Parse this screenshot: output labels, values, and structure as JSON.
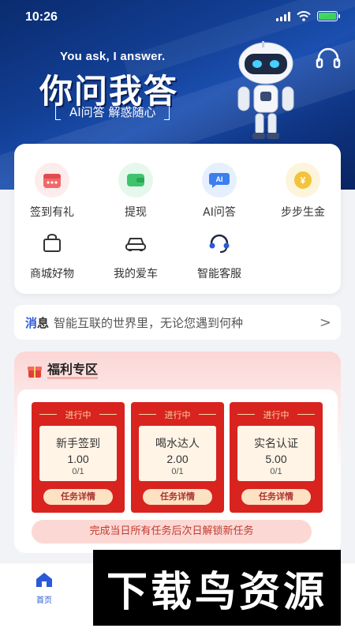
{
  "status_bar": {
    "time": "10:26"
  },
  "hero": {
    "subtitle": "You ask, I answer.",
    "title": "你问我答",
    "tagline": "AI问答 解惑随心",
    "headset_icon": "headset-icon",
    "robot": "robot-illustration"
  },
  "menu": {
    "items": [
      {
        "label": "签到有礼",
        "icon": "checkin-calendar-icon",
        "color": "#f1686a"
      },
      {
        "label": "提现",
        "icon": "wallet-icon",
        "color": "#3ec46d"
      },
      {
        "label": "AI问答",
        "icon": "ai-chat-icon",
        "color": "#3a7ef0"
      },
      {
        "label": "步步生金",
        "icon": "coin-icon",
        "color": "#f3c33a"
      },
      {
        "label": "商城好物",
        "icon": "shopping-bag-icon",
        "color": "#333333"
      },
      {
        "label": "我的爱车",
        "icon": "car-icon",
        "color": "#333333"
      },
      {
        "label": "智能客服",
        "icon": "customer-service-icon",
        "color": "#2b5ad8"
      }
    ]
  },
  "notice": {
    "tag_prefix": "消",
    "tag_suffix": "息",
    "text": "智能互联的世界里，无论您遇到何种",
    "arrow": ">"
  },
  "welfare": {
    "title": "福利专区",
    "tasks": [
      {
        "status": "进行中",
        "name": "新手签到",
        "reward": "1.00",
        "progress": "0/1",
        "button": "任务详情"
      },
      {
        "status": "进行中",
        "name": "喝水达人",
        "reward": "2.00",
        "progress": "0/1",
        "button": "任务详情"
      },
      {
        "status": "进行中",
        "name": "实名认证",
        "reward": "5.00",
        "progress": "0/1",
        "button": "任务详情"
      }
    ],
    "unlock_text": "完成当日所有任务后次日解锁新任务"
  },
  "tabbar": {
    "home_label": "首页"
  },
  "watermark": "下载鸟资源",
  "colors": {
    "accent_blue": "#2b5ad8",
    "task_red": "#d8231f",
    "hero_blue": "#123e93"
  }
}
